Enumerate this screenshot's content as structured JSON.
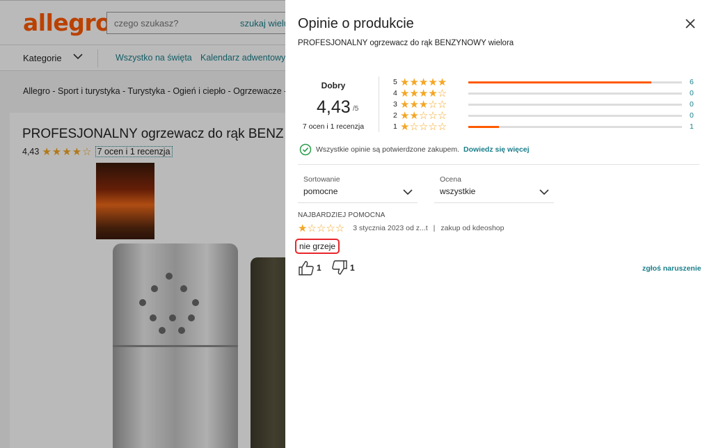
{
  "background": {
    "logo": "allegro",
    "search_placeholder": "czego szukasz?",
    "search_button": "szukaj wielu",
    "nav": {
      "categories": "Kategorie",
      "links": [
        "Wszystko na święta",
        "Kalendarz adwentowy"
      ]
    },
    "breadcrumb": "Allegro  -  Sport i turystyka  -  Turystyka  -  Ogień i ciepło  -  Ogrzewacze  -",
    "product_title": "PROFESJONALNY ogrzewacz do rąk BENZ",
    "product_rating": "4,43",
    "product_rating_stars": "★★★★☆",
    "product_rating_link": "7 ocen i 1 recenzja"
  },
  "panel": {
    "title": "Opinie o produkcie",
    "product_name": "PROFESJONALNY ogrzewacz do rąk BENZYNOWY wielora",
    "summary": {
      "label": "Dobry",
      "score": "4,43",
      "max": "/5",
      "count": "7 ocen i 1 recenzja"
    },
    "distribution": [
      {
        "stars": "5",
        "icons": "★★★★★",
        "count": "6",
        "fraction": 0.857
      },
      {
        "stars": "4",
        "icons": "★★★★☆",
        "count": "0",
        "fraction": 0
      },
      {
        "stars": "3",
        "icons": "★★★☆☆",
        "count": "0",
        "fraction": 0
      },
      {
        "stars": "2",
        "icons": "★★☆☆☆",
        "count": "0",
        "fraction": 0
      },
      {
        "stars": "1",
        "icons": "★☆☆☆☆",
        "count": "1",
        "fraction": 0.143
      }
    ],
    "verified_text": "Wszystkie opinie są potwierdzone zakupem.",
    "verified_link": "Dowiedz się więcej",
    "sort": {
      "label": "Sortowanie",
      "value": "pomocne"
    },
    "filter": {
      "label": "Ocena",
      "value": "wszystkie"
    },
    "review": {
      "heading": "NAJBARDZIEJ POMOCNA",
      "stars": "★☆☆☆☆",
      "date": "3 stycznia 2023 od z...t",
      "separator": "|",
      "seller": "zakup od kdeoshop",
      "text": "nie grzeje",
      "likes": "1",
      "dislikes": "1",
      "report": "zgłoś naruszenie"
    },
    "colors": {
      "accent": "#ff5a00",
      "link": "#1a7e8a",
      "star": "#f5a623",
      "highlight": "#e8262a"
    }
  }
}
